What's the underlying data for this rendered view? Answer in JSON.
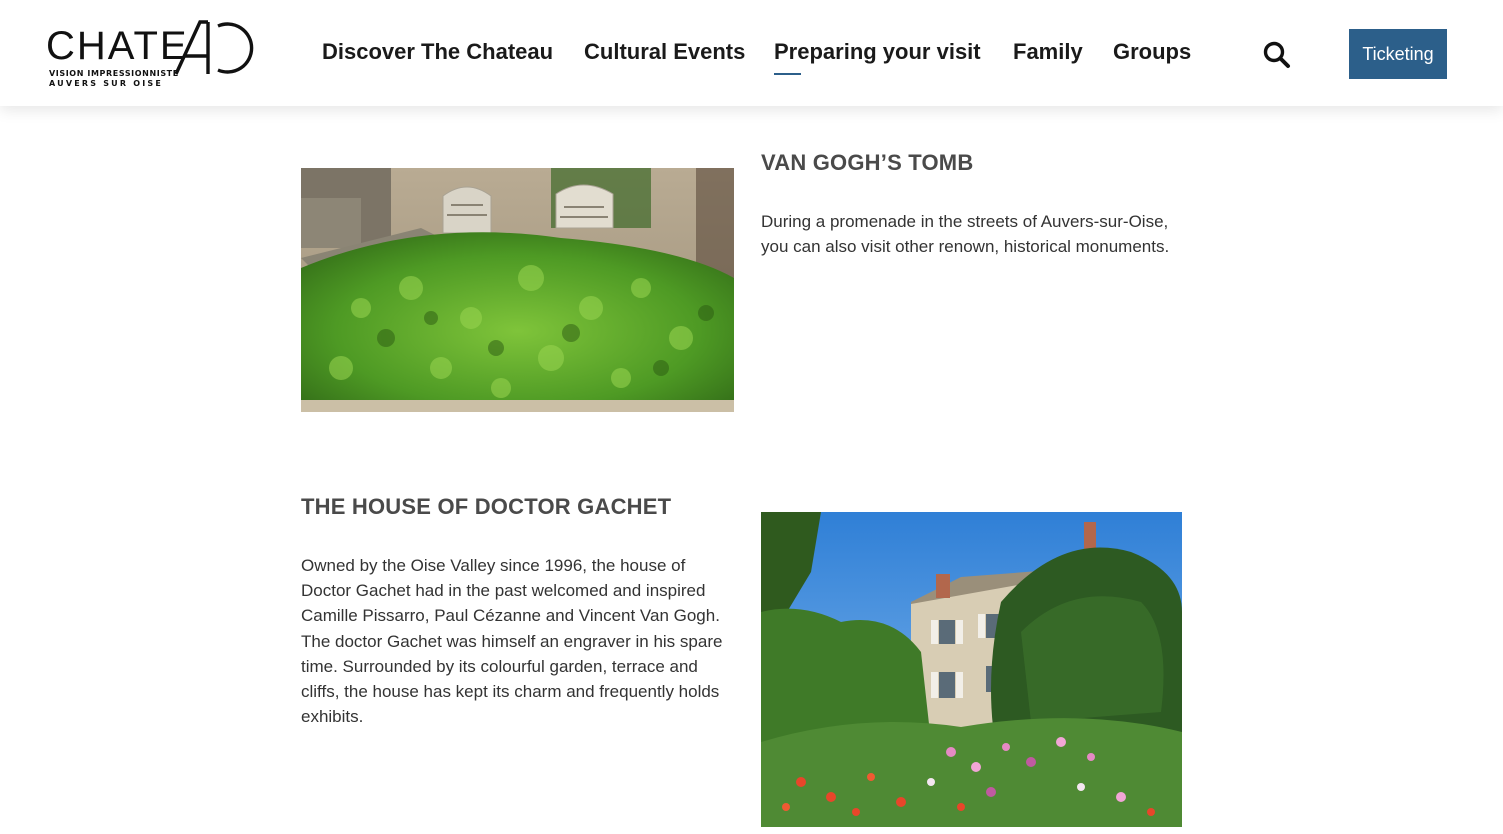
{
  "brand": {
    "logo_word": "CHATE",
    "tagline_1": "VISION IMPRESSIONNISTE",
    "tagline_2": "AUVERS SUR OISE",
    "accent_color": "#2c5f8a"
  },
  "nav": {
    "items": [
      {
        "label": "Discover The Chateau"
      },
      {
        "label": "Cultural Events"
      },
      {
        "label": "Preparing your visit",
        "active": true
      },
      {
        "label": "Family"
      },
      {
        "label": "Groups"
      }
    ],
    "search_icon": "search-icon",
    "ticketing_label": "Ticketing"
  },
  "sections": [
    {
      "title": "VAN GOGH’S TOMB",
      "text": "During a promenade in the streets of Auvers-sur-Oise, you can also visit other renown, historical monuments.",
      "image": "tomb-photo"
    },
    {
      "title": "THE HOUSE OF DOCTOR GACHET",
      "text": "Owned by the Oise Valley since 1996, the house of Doctor Gachet had in the past welcomed and inspired Camille Pissarro, Paul Cézanne and Vincent Van Gogh. The doctor Gachet was himself an engraver in his spare time. Surrounded by its colourful garden, terrace and cliffs, the house has kept its charm and frequently holds exhibits.",
      "image": "house-photo"
    }
  ]
}
